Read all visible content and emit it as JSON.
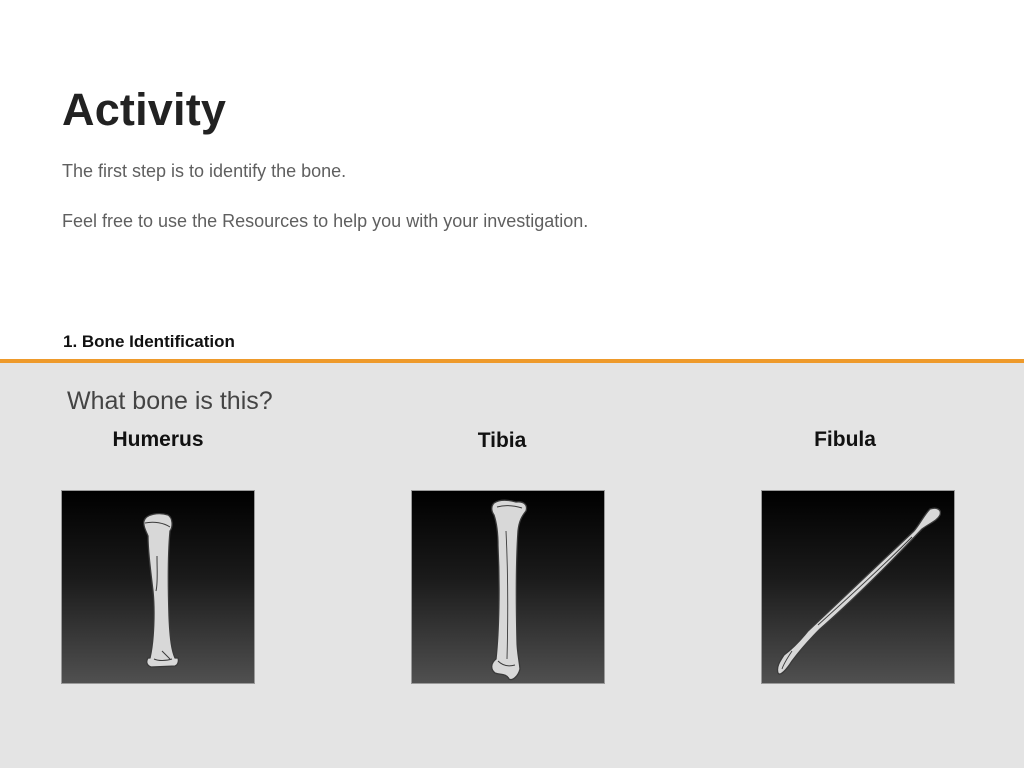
{
  "page": {
    "title": "Activity",
    "intro_lines": [
      "The first step is to identify the bone.",
      "Feel free to use the Resources to help you with your investigation."
    ],
    "section_label": "1. Bone Identification"
  },
  "question": {
    "text": "What bone is this?",
    "options": [
      {
        "label": "Humerus",
        "icon": "humerus-bone-icon"
      },
      {
        "label": "Tibia",
        "icon": "tibia-bone-icon"
      },
      {
        "label": "Fibula",
        "icon": "fibula-bone-icon"
      }
    ]
  },
  "colors": {
    "accent_rule": "#ee9a2b",
    "panel_bg": "#e4e4e4",
    "bone_fill": "#d8d8d8"
  }
}
